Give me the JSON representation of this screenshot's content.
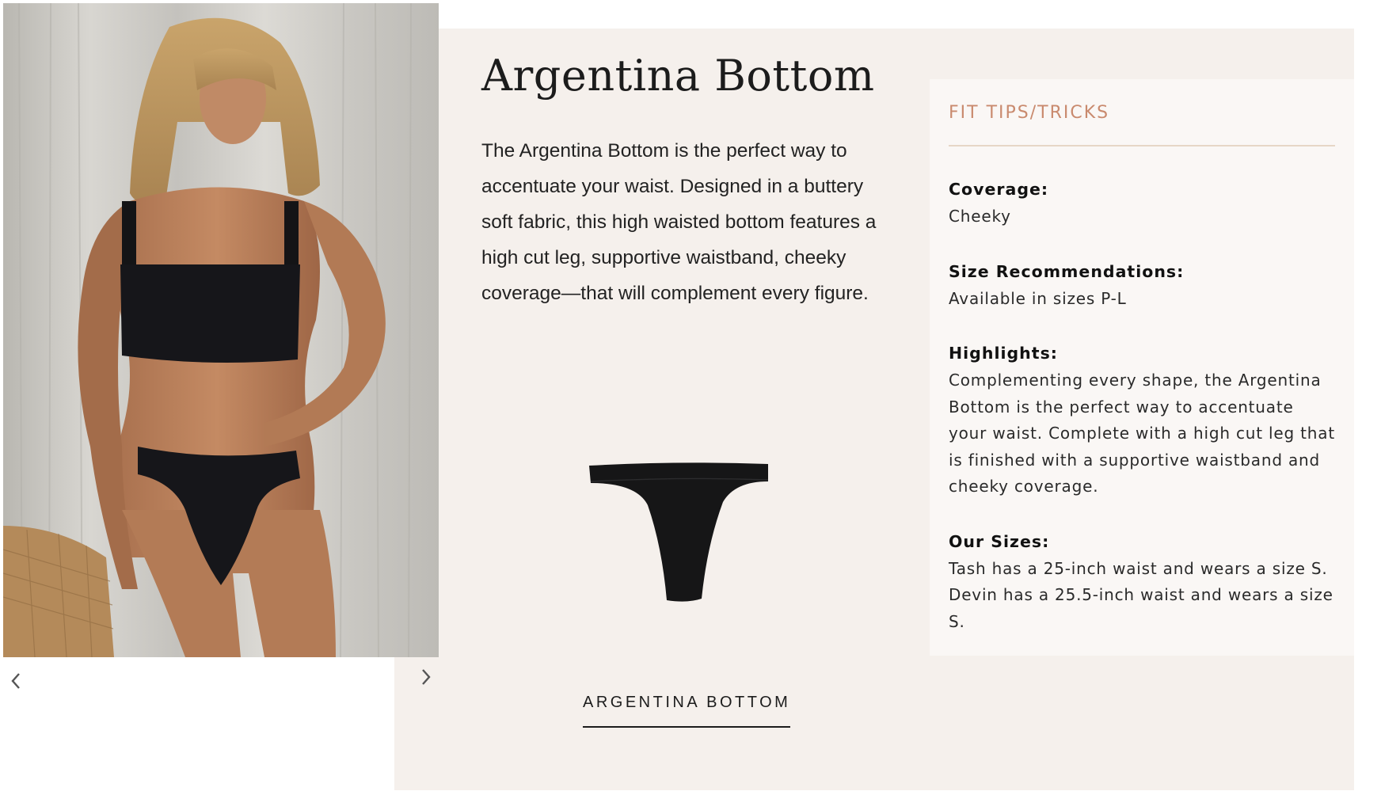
{
  "carousel": {
    "prev_icon": "chevron-left-icon",
    "next_icon": "chevron-right-icon"
  },
  "product": {
    "title": "Argentina Bottom",
    "description": "The Argentina Bottom is the perfect way to accentuate your waist. Designed in a buttery soft fabric, this high waisted bottom features a high cut leg, supportive waistband, cheeky coverage—that will complement every figure.",
    "swatch_label": "ARGENTINA BOTTOM"
  },
  "fit_tips": {
    "heading": "FIT TIPS/TRICKS",
    "coverage_label": "Coverage:",
    "coverage_value": "Cheeky",
    "size_rec_label": "Size Recommendations:",
    "size_rec_value": "Available in sizes P-L",
    "highlights_label": "Highlights:",
    "highlights_value": "Complementing every shape, the Argentina Bottom is the perfect way to accentuate your waist. Complete with a high cut leg that is finished with a supportive waistband and cheeky coverage.",
    "our_sizes_label": "Our Sizes:",
    "our_sizes_value": "Tash has a 25-inch waist and wears a size S. Devin has a 25.5-inch waist and wears a size S."
  },
  "colors": {
    "accent": "#c98a6e",
    "panel_bg": "#f5f0ec",
    "card_bg": "#faf7f5",
    "text": "#1c1c1c"
  }
}
